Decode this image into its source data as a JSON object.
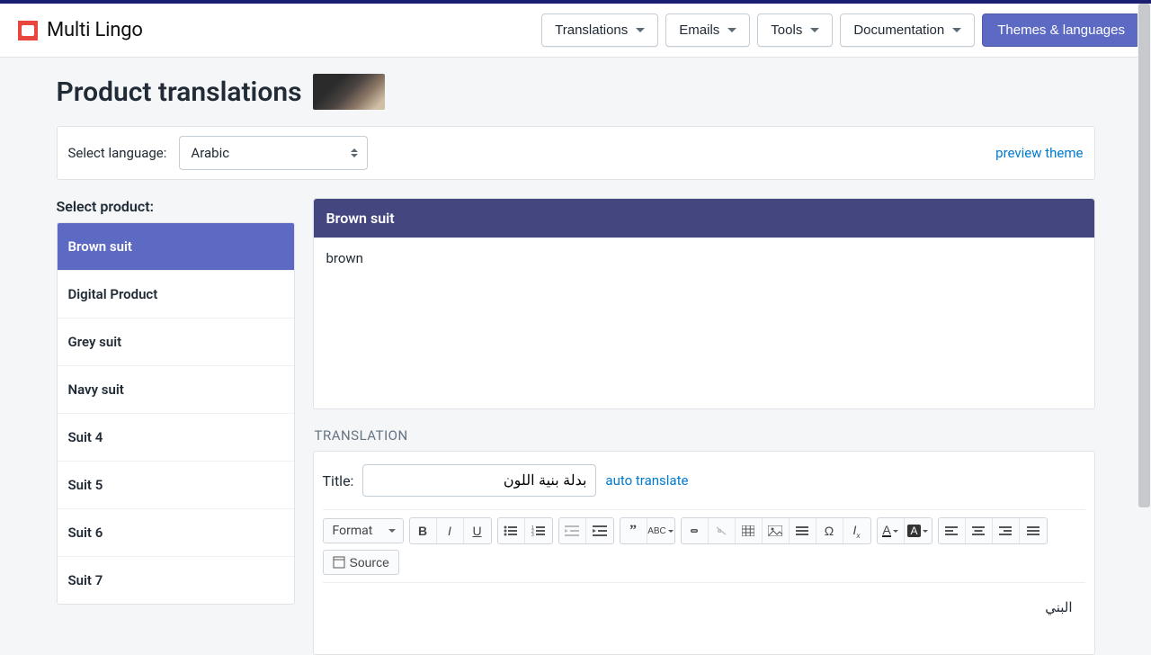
{
  "app": {
    "name": "Multi Lingo"
  },
  "header": {
    "nav": {
      "translations": "Translations",
      "emails": "Emails",
      "tools": "Tools",
      "documentation": "Documentation"
    },
    "themes_btn": "Themes & languages"
  },
  "page": {
    "title": "Product translations",
    "language_label": "Select language:",
    "language_selected": "Arabic",
    "preview_link": "preview theme"
  },
  "sidebar": {
    "title": "Select product:",
    "items": [
      "Brown suit",
      "Digital Product",
      "Grey suit",
      "Navy suit",
      "Suit 4",
      "Suit 5",
      "Suit 6",
      "Suit 7"
    ],
    "active_index": 0
  },
  "source_panel": {
    "title": "Brown suit",
    "body": "brown"
  },
  "translation": {
    "section_label": "TRANSLATION",
    "title_label": "Title:",
    "title_value": "بدلة بنية اللون",
    "auto_translate": "auto translate",
    "editor_body": "البني",
    "format_label": "Format",
    "source_label": "Source"
  }
}
